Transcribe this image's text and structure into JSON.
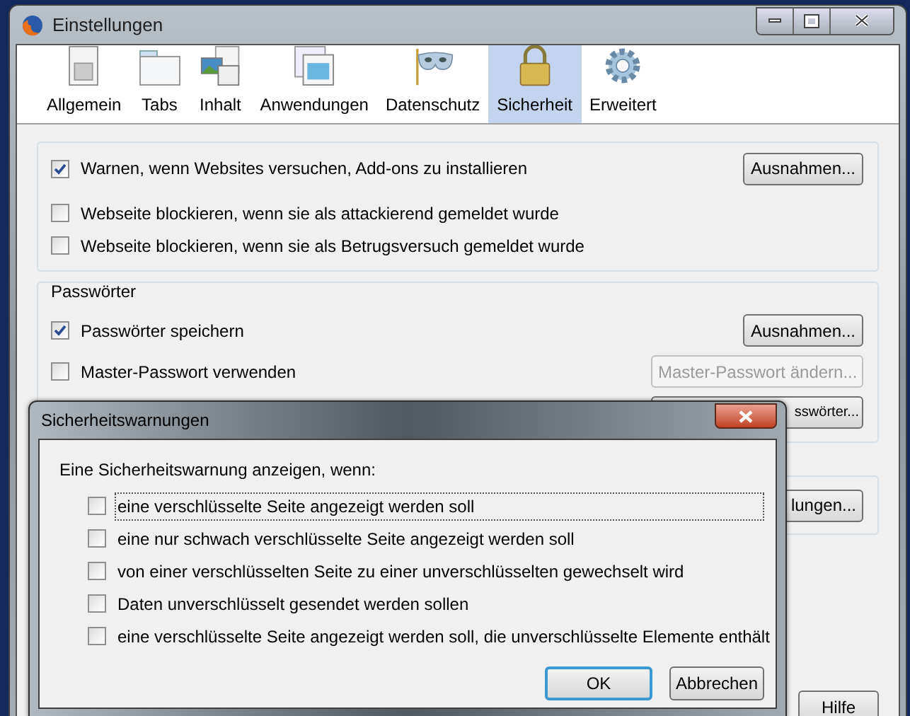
{
  "window": {
    "title": "Einstellungen"
  },
  "toolbar": [
    {
      "label": "Allgemein",
      "selected": false,
      "kind": "switch"
    },
    {
      "label": "Tabs",
      "selected": false,
      "kind": "tabs"
    },
    {
      "label": "Inhalt",
      "selected": false,
      "kind": "content"
    },
    {
      "label": "Anwendungen",
      "selected": false,
      "kind": "apps"
    },
    {
      "label": "Datenschutz",
      "selected": false,
      "kind": "mask"
    },
    {
      "label": "Sicherheit",
      "selected": true,
      "kind": "lock"
    },
    {
      "label": "Erweitert",
      "selected": false,
      "kind": "gear"
    }
  ],
  "security": {
    "options": [
      {
        "label": "Warnen, wenn Websites versuchen, Add-ons zu installieren",
        "checked": true
      },
      {
        "label": "Webseite blockieren, wenn sie als attackierend gemeldet wurde",
        "checked": false
      },
      {
        "label": "Webseite blockieren, wenn sie als Betrugsversuch gemeldet wurde",
        "checked": false
      }
    ],
    "button": "Ausnahmen..."
  },
  "passwords": {
    "title": "Passwörter",
    "options": [
      {
        "label": "Passwörter speichern",
        "checked": true,
        "button": {
          "label": "Ausnahmen...",
          "disabled": false
        }
      },
      {
        "label": "Master-Passwort verwenden",
        "checked": false,
        "button": {
          "label": "Master-Passwort ändern...",
          "disabled": true
        }
      }
    ],
    "saved_button": "sswörter..."
  },
  "warnings_button": "lungen...",
  "help_button": "Hilfe",
  "dialog": {
    "title": "Sicherheitswarnungen",
    "prompt": "Eine Sicherheitswarnung anzeigen, wenn:",
    "options": [
      {
        "label": "eine verschlüsselte Seite angezeigt werden soll",
        "checked": false,
        "focused": true
      },
      {
        "label": "eine nur schwach verschlüsselte Seite angezeigt werden soll",
        "checked": false,
        "focused": false
      },
      {
        "label": "von einer verschlüsselten Seite zu einer unverschlüsselten gewechselt wird",
        "checked": false,
        "focused": false
      },
      {
        "label": "Daten unverschlüsselt gesendet werden sollen",
        "checked": false,
        "focused": false
      },
      {
        "label": "eine verschlüsselte Seite angezeigt werden soll, die unverschlüsselte Elemente enthält",
        "checked": false,
        "focused": false
      }
    ],
    "buttons": [
      {
        "label": "OK",
        "default": true
      },
      {
        "label": "Abbrechen",
        "default": false
      }
    ]
  }
}
